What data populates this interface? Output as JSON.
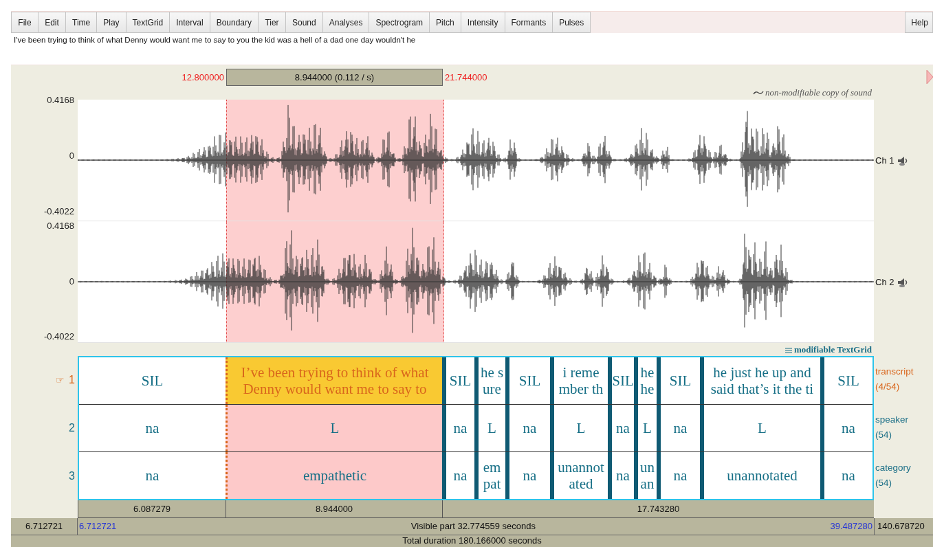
{
  "menu": [
    "File",
    "Edit",
    "Time",
    "Play",
    "TextGrid",
    "Interval",
    "Boundary",
    "Tier",
    "Sound",
    "Analyses",
    "Spectrogram",
    "Pitch",
    "Intensity",
    "Formants",
    "Pulses"
  ],
  "help_button": "Help",
  "transcript_field": {
    "value": "I've been trying to think of what Denny would want me to say to you the kid was a hell of a dad one day wouldn't he"
  },
  "selection": {
    "start": "12.800000",
    "duration": "8.944000 (0.112 / s)",
    "end": "21.744000"
  },
  "sound": {
    "title": "non-modifiable copy of sound",
    "channels": [
      {
        "label": "Ch 1",
        "max": "0.4168",
        "zero": "0",
        "min": "-0.4022"
      },
      {
        "label": "Ch 2",
        "max": "0.4168",
        "zero": "0",
        "min": "-0.4022"
      }
    ]
  },
  "textgrid_title": "modifiable TextGrid",
  "tiers": [
    {
      "marker": "☞",
      "number": "1",
      "name": "transcript",
      "count": "(4/54)",
      "selected": true,
      "intervals": [
        {
          "text": "SIL",
          "selected": false
        },
        {
          "text": "I’ve been trying to think of what\nDenny would want me to say to",
          "selected": true
        },
        {
          "text": "SIL",
          "selected": false
        },
        {
          "text": "he s\nure",
          "selected": false
        },
        {
          "text": "SIL",
          "selected": false
        },
        {
          "text": "i reme\nmber th",
          "selected": false
        },
        {
          "text": "SIL",
          "selected": false
        },
        {
          "text": "he\nhe",
          "selected": false
        },
        {
          "text": "SIL",
          "selected": false
        },
        {
          "text": "he just he up and\nsaid that’s it the ti",
          "selected": false
        },
        {
          "text": "SIL",
          "selected": false
        }
      ]
    },
    {
      "number": "2",
      "name": "speaker",
      "count": "(54)",
      "selected": false,
      "intervals": [
        {
          "text": "na",
          "selected": false
        },
        {
          "text": "L",
          "selected": true
        },
        {
          "text": "na",
          "selected": false
        },
        {
          "text": "L",
          "selected": false
        },
        {
          "text": "na",
          "selected": false
        },
        {
          "text": "L",
          "selected": false
        },
        {
          "text": "na",
          "selected": false
        },
        {
          "text": "L",
          "selected": false
        },
        {
          "text": "na",
          "selected": false
        },
        {
          "text": "L",
          "selected": false
        },
        {
          "text": "na",
          "selected": false
        }
      ]
    },
    {
      "number": "3",
      "name": "category",
      "count": "(54)",
      "selected": false,
      "intervals": [
        {
          "text": "na",
          "selected": false
        },
        {
          "text": "empathetic",
          "selected": true
        },
        {
          "text": "na",
          "selected": false
        },
        {
          "text": "em\npat",
          "selected": false
        },
        {
          "text": "na",
          "selected": false
        },
        {
          "text": "unannot\nated",
          "selected": false
        },
        {
          "text": "na",
          "selected": false
        },
        {
          "text": "un\nan",
          "selected": false
        },
        {
          "text": "na",
          "selected": false
        },
        {
          "text": "unannotated",
          "selected": false
        },
        {
          "text": "na",
          "selected": false
        }
      ]
    }
  ],
  "durations": [
    "6.087279",
    "8.944000",
    "17.743280"
  ],
  "visible": {
    "left_outside": "6.712721",
    "start": "6.712721",
    "label": "Visible part 32.774559 seconds",
    "end": "39.487280",
    "right_outside": "140.678720"
  },
  "total": "Total duration 180.166000 seconds"
}
